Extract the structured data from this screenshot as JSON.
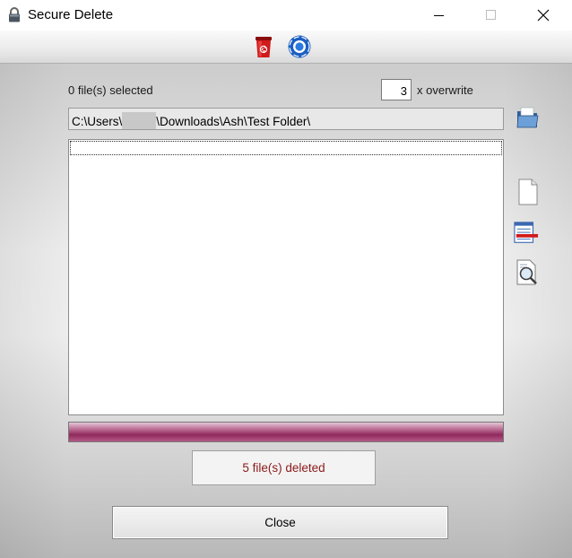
{
  "window": {
    "title": "Secure Delete",
    "icon": "lock-icon"
  },
  "titlebar_buttons": [
    "minimize-icon",
    "maximize-icon",
    "close-icon"
  ],
  "toolbar": {
    "icons": [
      "delete-bin-icon",
      "help-lifebuoy-icon"
    ]
  },
  "selection": {
    "count_label": "0 file(s) selected"
  },
  "overwrite": {
    "value": "3",
    "label": "x overwrite"
  },
  "path": {
    "prefix": "C:\\Users\\",
    "suffix": "\\Downloads\\Ash\\Test Folder\\"
  },
  "side_icons": [
    "open-folder-icon",
    "new-file-icon",
    "remove-list-icon",
    "file-search-icon"
  ],
  "file_list": {
    "items": []
  },
  "progress": {
    "percent": 100
  },
  "status": {
    "text": "5 file(s) deleted",
    "color": "#8b1a1a"
  },
  "buttons": {
    "close_label": "Close"
  }
}
